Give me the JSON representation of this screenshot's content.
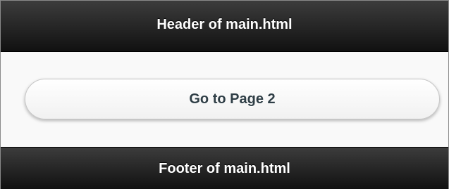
{
  "header": {
    "title": "Header of main.html"
  },
  "content": {
    "button_label": "Go to Page 2"
  },
  "footer": {
    "title": "Footer of main.html"
  },
  "colors": {
    "bar_top": "#3c3c3c",
    "bar_bottom": "#111111",
    "bar_text": "#ffffff",
    "content_bg": "#f9f9f9",
    "button_text": "#2f3e46"
  }
}
